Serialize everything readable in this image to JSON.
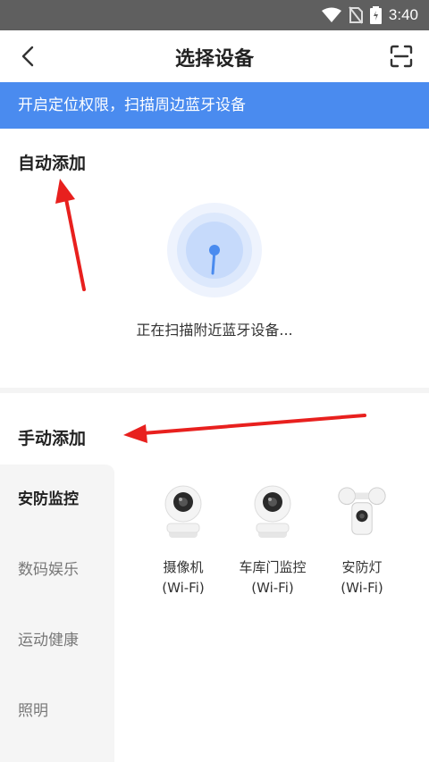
{
  "status": {
    "time": "3:40"
  },
  "header": {
    "title": "选择设备"
  },
  "banner": {
    "text": "开启定位权限，扫描周边蓝牙设备"
  },
  "auto": {
    "title": "自动添加",
    "scanning_text": "正在扫描附近蓝牙设备..."
  },
  "manual": {
    "title": "手动添加",
    "categories": [
      {
        "label": "安防监控"
      },
      {
        "label": "数码娱乐"
      },
      {
        "label": "运动健康"
      },
      {
        "label": "照明"
      }
    ],
    "devices": [
      {
        "name": "摄像机",
        "net": "(Wi-Fi)",
        "icon": "camera-icon"
      },
      {
        "name": "车库门监控",
        "net": "(Wi-Fi)",
        "icon": "camera-icon"
      },
      {
        "name": "安防灯",
        "net": "(Wi-Fi)",
        "icon": "floodlight-icon"
      }
    ]
  },
  "colors": {
    "accent": "#4a8bef",
    "annotation": "#e8201e"
  }
}
